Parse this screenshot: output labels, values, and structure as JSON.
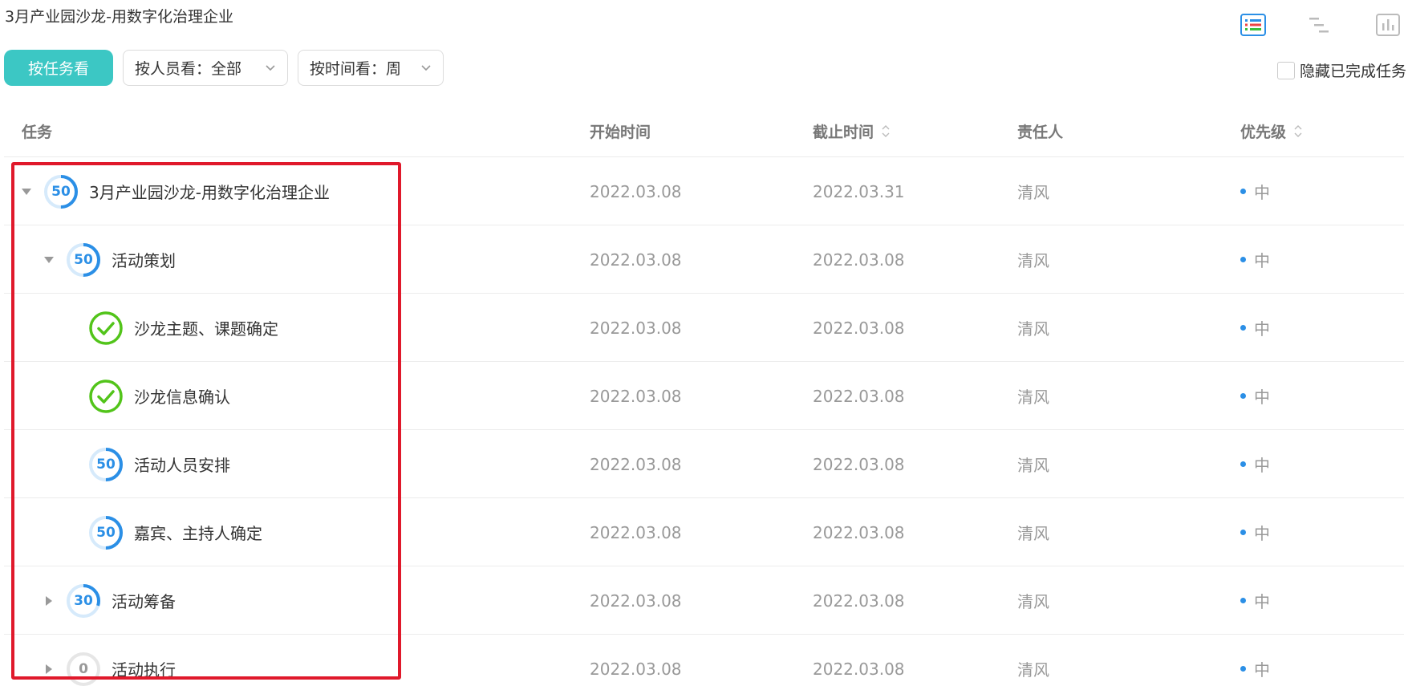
{
  "page": {
    "title": "3月产业园沙龙-用数字化治理企业"
  },
  "toolbar": {
    "by_task_label": "按任务看",
    "by_person_label": "按人员看：全部",
    "by_time_label": "按时间看：周",
    "hide_completed_label": "隐藏已完成任务"
  },
  "view_icons": [
    "list-view-icon",
    "gantt-view-icon",
    "stats-view-icon"
  ],
  "colors": {
    "accent": "#3cc7c4",
    "progress": "#2b8fe6",
    "done": "#52c41a",
    "highlight": "#e0192b"
  },
  "table": {
    "headers": {
      "task": "任务",
      "start": "开始时间",
      "end": "截止时间",
      "owner": "责任人",
      "priority": "优先级"
    },
    "rows": [
      {
        "name": "3月产业园沙龙-用数字化治理企业",
        "status": "50",
        "start": "2022.03.08",
        "end": "2022.03.31",
        "owner": "清风",
        "priority": "中"
      },
      {
        "name": "活动策划",
        "status": "50",
        "start": "2022.03.08",
        "end": "2022.03.08",
        "owner": "清风",
        "priority": "中"
      },
      {
        "name": "沙龙主题、课题确定",
        "status": "",
        "start": "2022.03.08",
        "end": "2022.03.08",
        "owner": "清风",
        "priority": "中"
      },
      {
        "name": "沙龙信息确认",
        "status": "",
        "start": "2022.03.08",
        "end": "2022.03.08",
        "owner": "清风",
        "priority": "中"
      },
      {
        "name": "活动人员安排",
        "status": "50",
        "start": "2022.03.08",
        "end": "2022.03.08",
        "owner": "清风",
        "priority": "中"
      },
      {
        "name": "嘉宾、主持人确定",
        "status": "50",
        "start": "2022.03.08",
        "end": "2022.03.08",
        "owner": "清风",
        "priority": "中"
      },
      {
        "name": "活动筹备",
        "status": "30",
        "start": "2022.03.08",
        "end": "2022.03.08",
        "owner": "清风",
        "priority": "中"
      },
      {
        "name": "活动执行",
        "status": "0",
        "start": "2022.03.08",
        "end": "2022.03.08",
        "owner": "清风",
        "priority": "中"
      }
    ]
  }
}
